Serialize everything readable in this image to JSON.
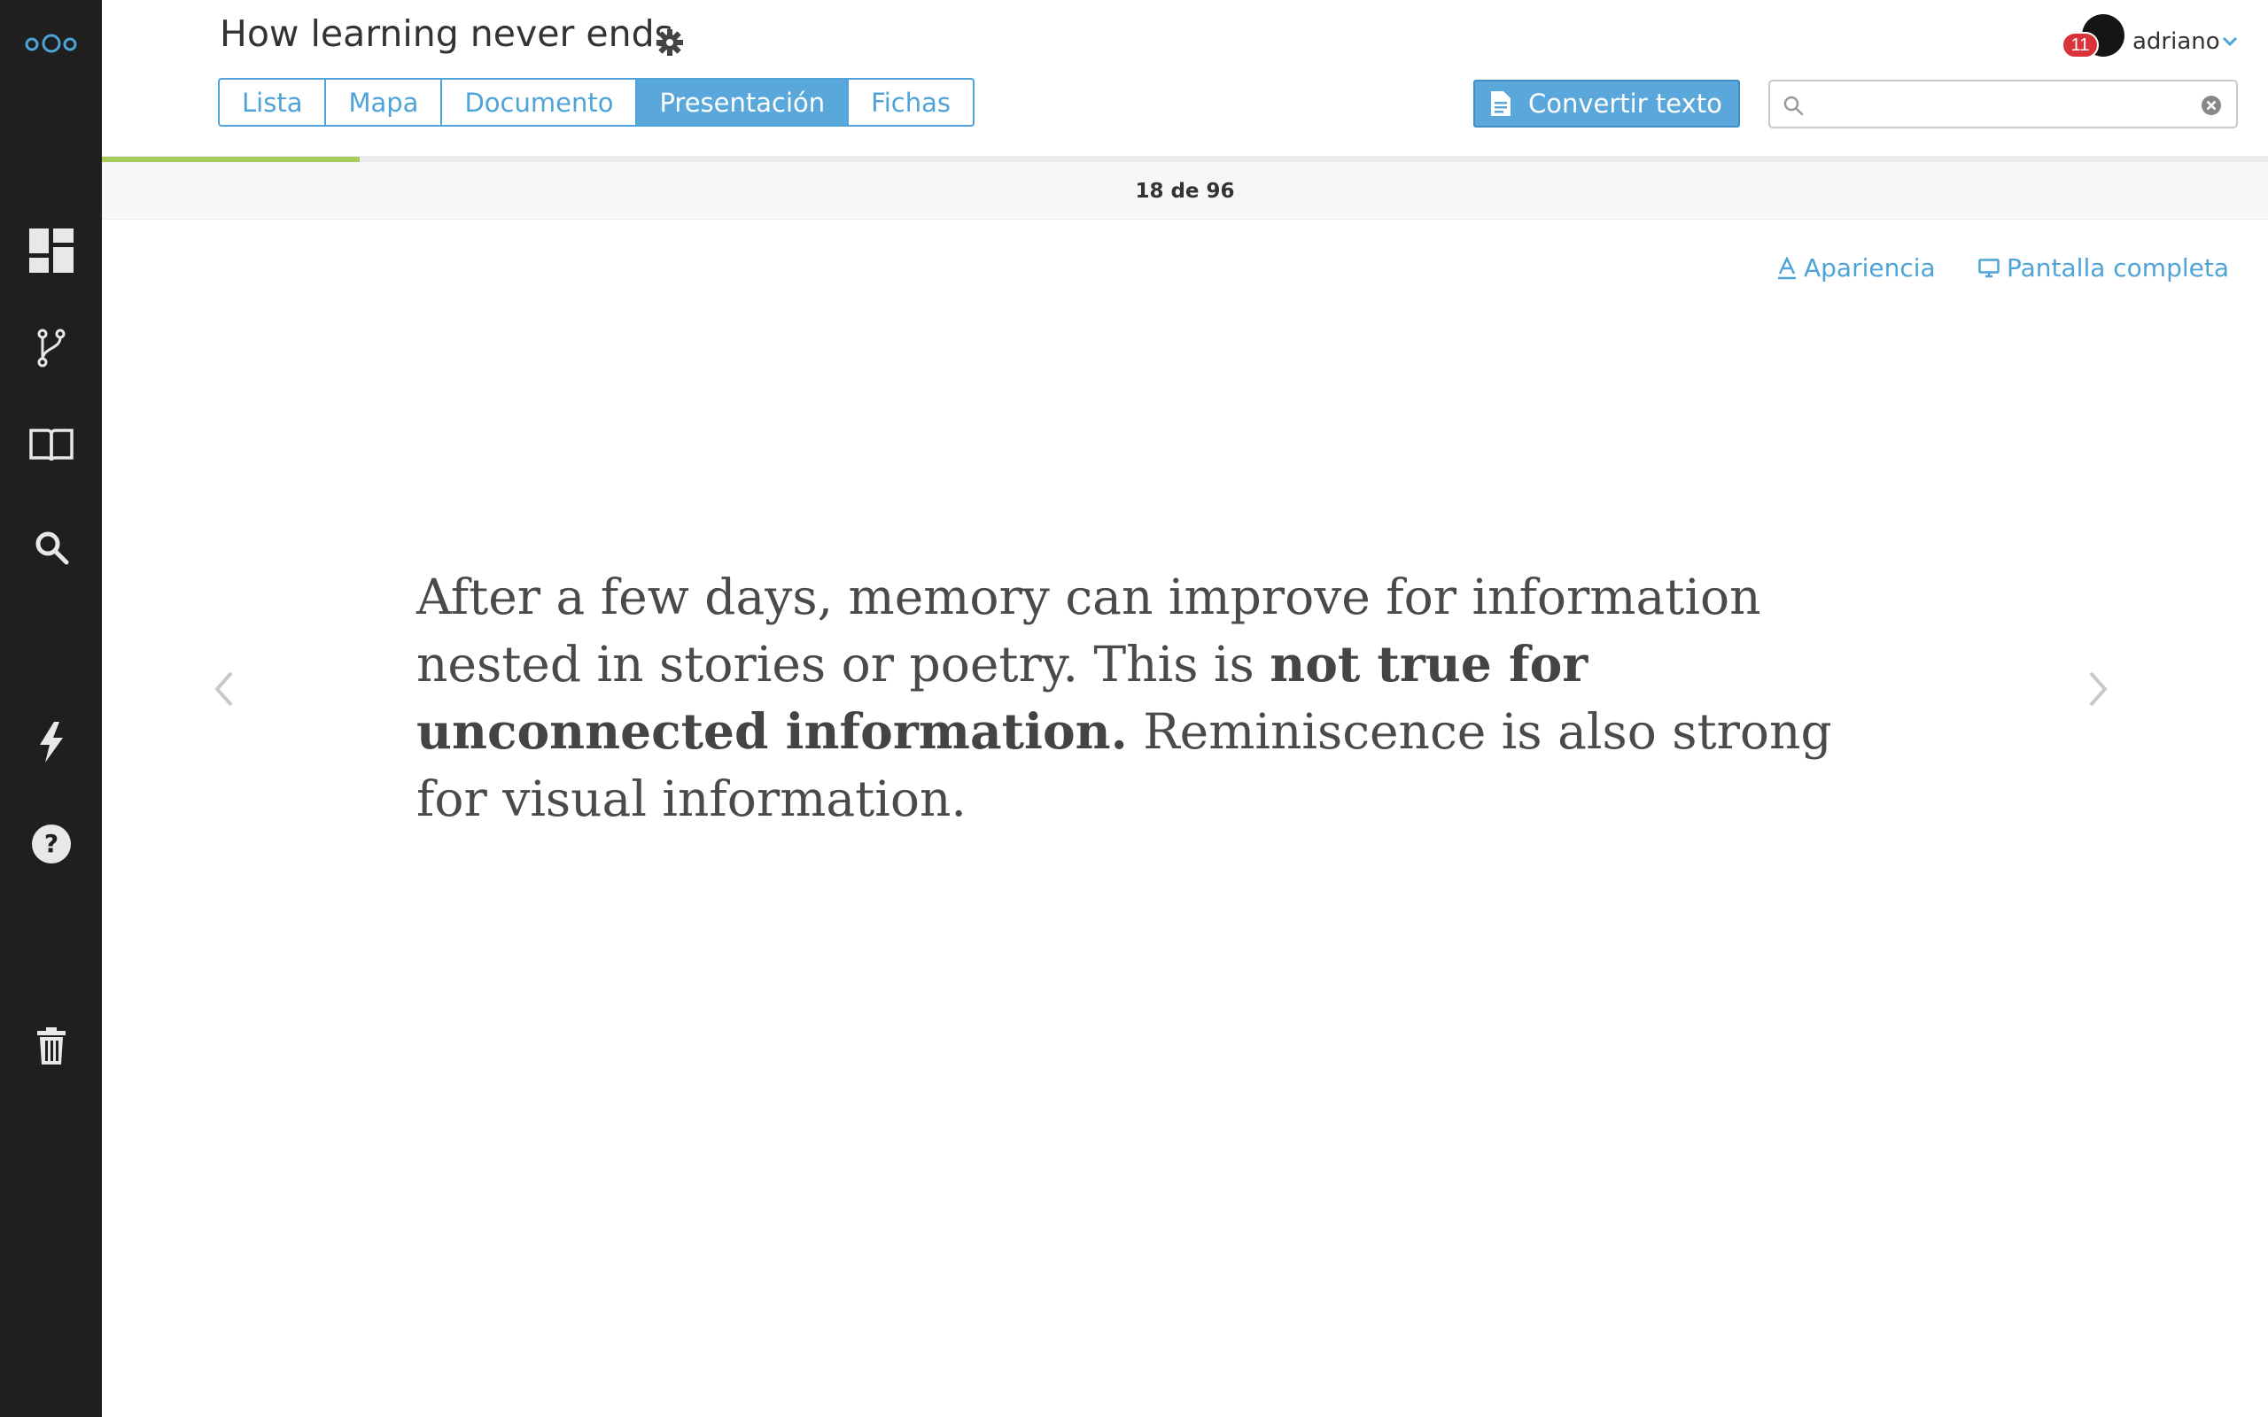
{
  "sidebar": {
    "logo": "nextcloud-logo-icon",
    "items": [
      {
        "name": "dashboard-icon"
      },
      {
        "name": "fork-icon"
      },
      {
        "name": "book-icon"
      },
      {
        "name": "search-icon"
      },
      {
        "name": "bolt-icon"
      },
      {
        "name": "help-icon"
      },
      {
        "name": "trash-icon"
      }
    ]
  },
  "header": {
    "title": "How learning never ends",
    "settings_icon": "gear-icon"
  },
  "tabs": [
    {
      "label": "Lista",
      "active": false
    },
    {
      "label": "Mapa",
      "active": false
    },
    {
      "label": "Documento",
      "active": false
    },
    {
      "label": "Presentación",
      "active": true
    },
    {
      "label": "Fichas",
      "active": false
    }
  ],
  "toolbar": {
    "convert_label": "Convertir texto",
    "search_placeholder": "",
    "search_value": ""
  },
  "user": {
    "name": "adriano",
    "notifications": "11"
  },
  "progress": {
    "current": 18,
    "total": 96,
    "label": "18 de 96",
    "fraction": 0.1875
  },
  "view_links": {
    "appearance": "Apariencia",
    "fullscreen": "Pantalla completa"
  },
  "slide": {
    "segments": [
      {
        "text": "After a few days, memory can improve for information nested in stories or poetry. This is ",
        "bold": false
      },
      {
        "text": "not true for unconnected information.",
        "bold": true
      },
      {
        "text": " Reminiscence is also strong for visual information.",
        "bold": false
      }
    ]
  },
  "colors": {
    "sidebar": "#1f1f1f",
    "accent": "#4ea3d8",
    "progress": "#a8cc5c",
    "badge": "#d9343b"
  }
}
